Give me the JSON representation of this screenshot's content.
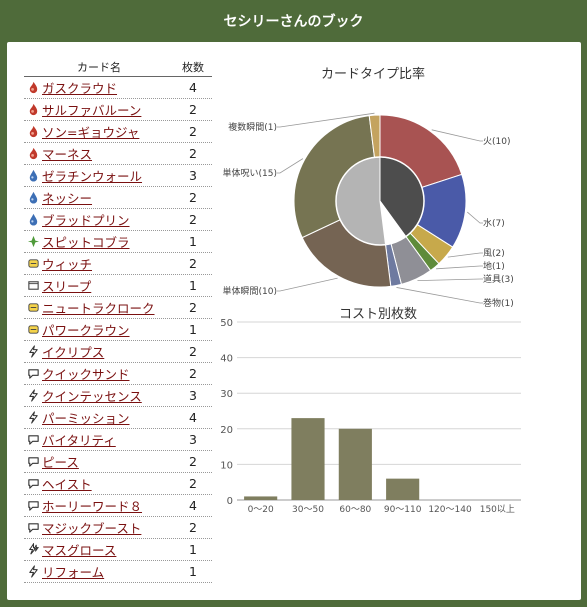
{
  "header": {
    "title": "セシリーさんのブック"
  },
  "table": {
    "col_name": "カード名",
    "col_count": "枚数",
    "rows": [
      {
        "icon": "fire-icon",
        "name": "ガスクラウド",
        "count": "4"
      },
      {
        "icon": "fire-icon",
        "name": "サルファバルーン",
        "count": "2"
      },
      {
        "icon": "fire-icon",
        "name": "ソン=ギョウジャ",
        "count": "2"
      },
      {
        "icon": "fire-icon",
        "name": "マーネス",
        "count": "2"
      },
      {
        "icon": "water-icon",
        "name": "ゼラチンウォール",
        "count": "3"
      },
      {
        "icon": "water-icon",
        "name": "ネッシー",
        "count": "2"
      },
      {
        "icon": "water-icon",
        "name": "ブラッドプリン",
        "count": "2"
      },
      {
        "icon": "wind-icon",
        "name": "スピットコブラ",
        "count": "1"
      },
      {
        "icon": "item-icon",
        "name": "ウィッチ",
        "count": "2"
      },
      {
        "icon": "scroll-icon",
        "name": "スリープ",
        "count": "1"
      },
      {
        "icon": "item-icon",
        "name": "ニュートラクローク",
        "count": "2"
      },
      {
        "icon": "item-icon",
        "name": "パワークラウン",
        "count": "1"
      },
      {
        "icon": "spell-single-icon",
        "name": "イクリプス",
        "count": "2"
      },
      {
        "icon": "spell-curse-icon",
        "name": "クイックサンド",
        "count": "2"
      },
      {
        "icon": "spell-single-icon",
        "name": "クインテッセンス",
        "count": "3"
      },
      {
        "icon": "spell-single-icon",
        "name": "パーミッション",
        "count": "4"
      },
      {
        "icon": "spell-curse-icon",
        "name": "バイタリティ",
        "count": "3"
      },
      {
        "icon": "spell-curse-icon",
        "name": "ピース",
        "count": "2"
      },
      {
        "icon": "spell-curse-icon",
        "name": "ヘイスト",
        "count": "2"
      },
      {
        "icon": "spell-curse-icon",
        "name": "ホーリーワード８",
        "count": "4"
      },
      {
        "icon": "spell-curse-icon",
        "name": "マジックブースト",
        "count": "2"
      },
      {
        "icon": "spell-multi-icon",
        "name": "マスグロース",
        "count": "1"
      },
      {
        "icon": "spell-single-icon",
        "name": "リフォーム",
        "count": "1"
      }
    ]
  },
  "chart_data": [
    {
      "type": "pie",
      "title": "カードタイプ比率",
      "outer": [
        {
          "label": "火(10)",
          "value": 10,
          "color": "#a85352"
        },
        {
          "label": "水(7)",
          "value": 7,
          "color": "#4a5aa8"
        },
        {
          "label": "風(2)",
          "value": 2,
          "color": "#c7a94b"
        },
        {
          "label": "地(1)",
          "value": 1,
          "color": "#5f8b3a"
        },
        {
          "label": "道具(3)",
          "value": 3,
          "color": "#8f8f96"
        },
        {
          "label": "巻物(1)",
          "value": 1,
          "color": "#6e7aa0"
        },
        {
          "label": "単体瞬間(10)",
          "value": 10,
          "color": "#756453"
        },
        {
          "label": "単体呪い(15)",
          "value": 15,
          "color": "#767452"
        },
        {
          "label": "複数瞬間(1)",
          "value": 1,
          "color": "#c4a35f"
        }
      ],
      "inner": [
        {
          "value": 20,
          "color": "#4d4d4d"
        },
        {
          "value": 4,
          "color": "#ffffff"
        },
        {
          "value": 26,
          "color": "#b4b4b4"
        }
      ]
    },
    {
      "type": "bar",
      "title": "コスト別枚数",
      "categories": [
        "0～20",
        "30～50",
        "60～80",
        "90～110",
        "120～140",
        "150以上"
      ],
      "values": [
        1,
        23,
        20,
        6,
        0,
        0
      ],
      "ylim": [
        0,
        50
      ],
      "yticks": [
        "0",
        "10",
        "20",
        "30",
        "40",
        "50"
      ],
      "bar_color": "#7f7e5f",
      "grid": true
    }
  ]
}
